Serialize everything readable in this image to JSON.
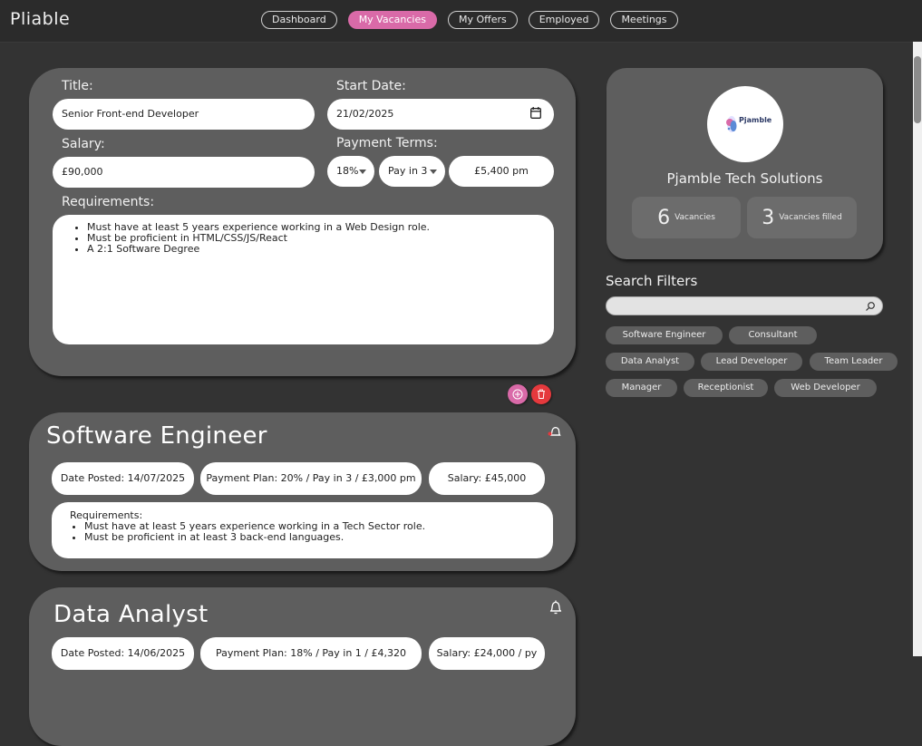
{
  "app": {
    "brand": "Pliable"
  },
  "nav": {
    "items": [
      {
        "label": "Dashboard"
      },
      {
        "label": "My Vacancies"
      },
      {
        "label": "My Offers"
      },
      {
        "label": "Employed"
      },
      {
        "label": "Meetings"
      }
    ],
    "active": "My Vacancies"
  },
  "form": {
    "title_label": "Title:",
    "title_value": "Senior Front-end Developer",
    "start_date_label": "Start Date:",
    "start_date_value": "21/02/2025",
    "salary_label": "Salary:",
    "salary_value": "£90,000",
    "payment_terms_label": "Payment Terms:",
    "percent_value": "18%",
    "installments_value": "Pay in 3",
    "monthly_value": "£5,400 pm",
    "requirements_label": "Requirements:",
    "requirements": [
      "Must have at least 5 years experience working in a Web Design role.",
      "Must be proficient in HTML/CSS/JS/React",
      "A 2:1 Software Degree"
    ]
  },
  "vacancies": [
    {
      "title": "Software Engineer",
      "date_posted": "Date Posted: 14/07/2025",
      "payment_plan": "Payment Plan: 20% / Pay in 3 / £3,000 pm",
      "salary": "Salary: £45,000",
      "requirements_heading": "Requirements:",
      "requirements": [
        "Must have at least 5 years experience working in a Tech Sector role.",
        "Must be proficient in at least 3 back-end languages."
      ]
    },
    {
      "title": "Data Analyst",
      "date_posted": "Date Posted: 14/06/2025",
      "payment_plan": "Payment Plan: 18% / Pay in 1 / £4,320",
      "salary": "Salary: £24,000 / py"
    }
  ],
  "company": {
    "logo_text": "Pjamble",
    "name": "Pjamble Tech Solutions",
    "vacancies_count": "6",
    "vacancies_label": "Vacancies",
    "filled_count": "3",
    "filled_label": "Vacancies filled"
  },
  "filters": {
    "title": "Search Filters",
    "chips": [
      "Software Engineer",
      "Consultant",
      "Data Analyst",
      "Lead Developer",
      "Team Leader",
      "Manager",
      "Receptionist",
      "Web Developer"
    ]
  },
  "colors": {
    "accent": "#d96aa8",
    "danger": "#e5393d",
    "card": "#5e5e5e",
    "background": "#333333"
  }
}
